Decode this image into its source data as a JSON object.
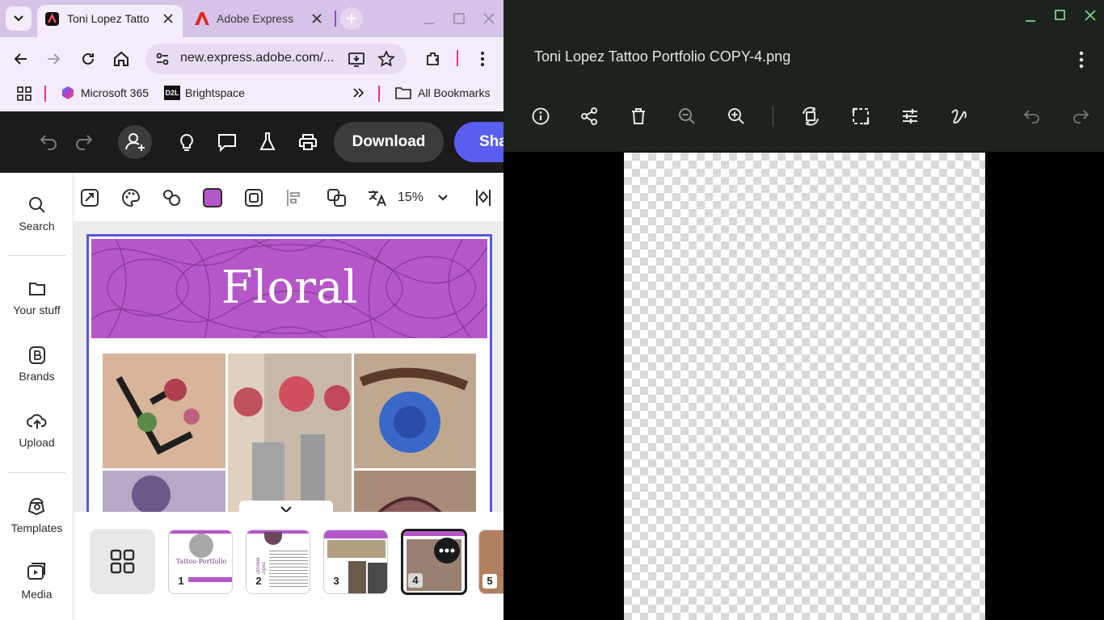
{
  "browser": {
    "tabs": [
      {
        "label": "Toni Lopez Tatto"
      },
      {
        "label": "Adobe Express -"
      }
    ],
    "url": "new.express.adobe.com/...",
    "bookmarks": [
      {
        "label": "Microsoft 365"
      },
      {
        "label": "Brightspace"
      }
    ],
    "bookmarks_folder": "All Bookmarks",
    "bookmark_badge": "D2L"
  },
  "express": {
    "download_label": "Download",
    "share_label": "Sha",
    "zoom": "15%",
    "rail": [
      {
        "label": "Search"
      },
      {
        "label": "Your stuff"
      },
      {
        "label": "Brands"
      },
      {
        "label": "Upload"
      },
      {
        "label": "Templates"
      },
      {
        "label": "Media"
      }
    ],
    "canvas": {
      "title": "Floral"
    },
    "pages": [
      {
        "num": "1",
        "thumb_text": "Tattoo Portfolio"
      },
      {
        "num": "2",
        "thumb_text": "Antonia Lopez"
      },
      {
        "num": "3"
      },
      {
        "num": "4"
      },
      {
        "num": "5"
      }
    ],
    "accent": "#5a5ef0",
    "brand_purple": "#b557c9"
  },
  "viewer": {
    "title": "Toni Lopez Tattoo Portfolio COPY-4.png"
  }
}
